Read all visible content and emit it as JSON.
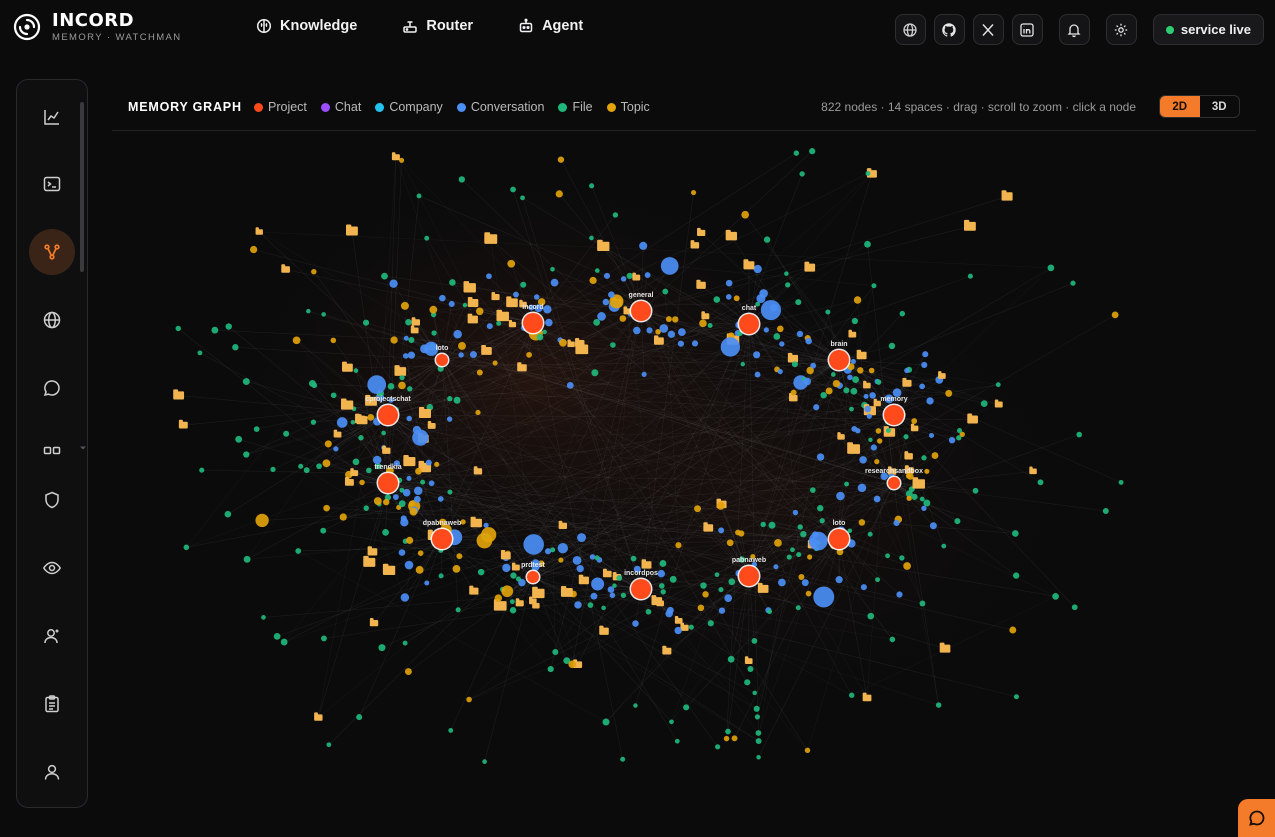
{
  "brand": {
    "name": "INCORD",
    "subtitle": "MEMORY · WATCHMAN"
  },
  "nav": [
    {
      "label": "Knowledge",
      "icon": "brain-icon"
    },
    {
      "label": "Router",
      "icon": "router-icon"
    },
    {
      "label": "Agent",
      "icon": "robot-icon"
    }
  ],
  "top_actions": {
    "icons": [
      "globe-icon",
      "github-icon",
      "x-icon",
      "linkedin-icon",
      "bell-icon",
      "gear-icon"
    ],
    "service_status": "service live",
    "status_color": "#2ecc71"
  },
  "sidebar": {
    "active": "graph",
    "items": [
      "chart-line-icon",
      "terminal-icon",
      "graph-icon",
      "globe-icon",
      "chat-bubble-icon",
      "apps-icon",
      "shield-icon",
      "eye-icon",
      "user-plus-icon",
      "clipboard-icon",
      "user-icon"
    ]
  },
  "graph": {
    "title": "MEMORY GRAPH",
    "legend": [
      {
        "label": "Project",
        "color": "#ff4a1c"
      },
      {
        "label": "Chat",
        "color": "#9b4dff"
      },
      {
        "label": "Company",
        "color": "#22c3ee"
      },
      {
        "label": "Conversation",
        "color": "#4b8ef5"
      },
      {
        "label": "File",
        "color": "#1fb87c"
      },
      {
        "label": "Topic",
        "color": "#e1a20a"
      }
    ],
    "stats": "822 nodes · 14 spaces · drag · scroll to zoom · click a node",
    "view_modes": [
      "2D",
      "3D"
    ],
    "active_mode": "2D",
    "projects": [
      {
        "label": "incord"
      },
      {
        "label": "general"
      },
      {
        "label": "chat"
      },
      {
        "label": "brain"
      },
      {
        "label": "loto"
      },
      {
        "label": "cprojectschat"
      },
      {
        "label": "memory"
      },
      {
        "label": "trendkia"
      },
      {
        "label": "researchsandbox"
      },
      {
        "label": "dpabnaweb"
      },
      {
        "label": "loto"
      },
      {
        "label": "prdtest"
      },
      {
        "label": "incordpos"
      },
      {
        "label": "pabnaweb"
      }
    ]
  },
  "colors": {
    "accent": "#f47b2a",
    "file_folder": "#f2b44f"
  }
}
